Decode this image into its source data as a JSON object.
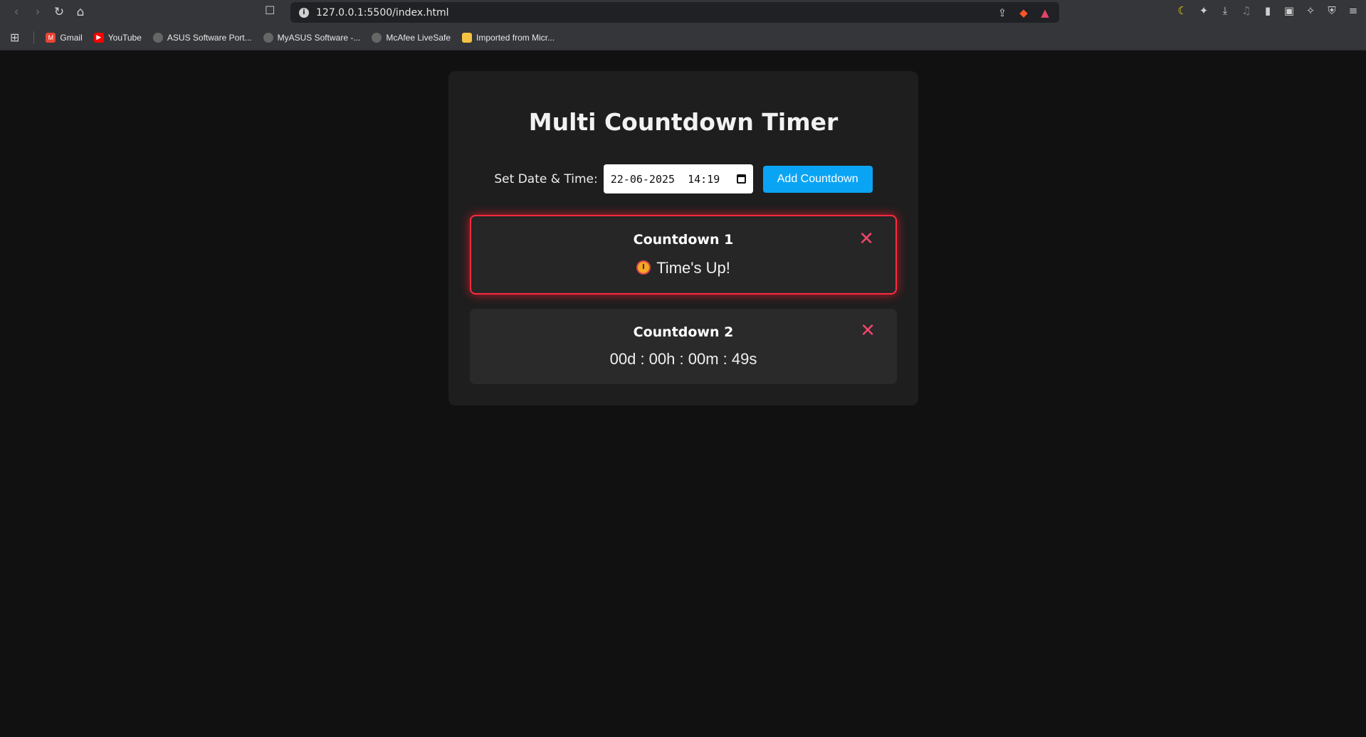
{
  "browser": {
    "url": "127.0.0.1:5500/index.html",
    "bookmarks": [
      {
        "label": "Gmail",
        "icon": "gmail-icon",
        "color": "#ea4335"
      },
      {
        "label": "YouTube",
        "icon": "youtube-icon",
        "color": "#ff0000"
      },
      {
        "label": "ASUS Software Port...",
        "icon": "globe-icon",
        "color": "#9e9e9e"
      },
      {
        "label": "MyASUS Software -...",
        "icon": "globe-icon",
        "color": "#9e9e9e"
      },
      {
        "label": "McAfee LiveSafe",
        "icon": "globe-icon",
        "color": "#9e9e9e"
      },
      {
        "label": "Imported from Micr...",
        "icon": "folder-icon",
        "color": "#f5c242"
      }
    ]
  },
  "app": {
    "title": "Multi Countdown Timer",
    "date_label": "Set Date & Time:",
    "datetime_value": "22-06-2025  14:19",
    "add_button": "Add Countdown",
    "accent_color": "#0aa4f5",
    "expired_color": "#ff2a3d",
    "countdowns": [
      {
        "title": "Countdown 1",
        "value": "Time's Up!",
        "status": "expired",
        "icon": "alarm-clock-icon"
      },
      {
        "title": "Countdown 2",
        "value": "00d : 00h : 00m : 49s",
        "status": "active"
      }
    ],
    "close_symbol": "✕"
  }
}
